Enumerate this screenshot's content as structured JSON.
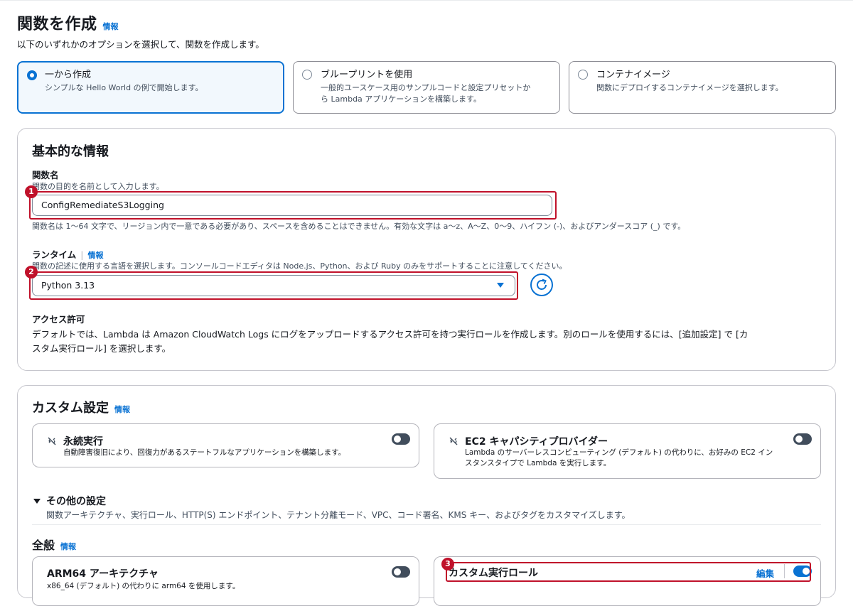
{
  "page": {
    "title": "関数を作成",
    "info": "情報",
    "description": "以下のいずれかのオプションを選択して、関数を作成します。"
  },
  "options": [
    {
      "title": "一から作成",
      "desc": "シンプルな Hello World の例で開始します。",
      "selected": true
    },
    {
      "title": "ブループリントを使用",
      "desc1": "一般的ユースケース用のサンプルコードと設定プリセットか",
      "desc2": "ら Lambda アプリケーションを構築します。",
      "selected": false
    },
    {
      "title": "コンテナイメージ",
      "desc": "関数にデプロイするコンテナイメージを選択します。",
      "selected": false
    }
  ],
  "basic": {
    "heading": "基本的な情報",
    "function_name": {
      "label": "関数名",
      "hint": "関数の目的を名前として入力します。",
      "value": "ConfigRemediateS3Logging",
      "constraint": "関数名は 1〜64 文字で、リージョン内で一意である必要があり、スペースを含めることはできません。有効な文字は a〜z、A〜Z、0〜9、ハイフン (-)、およびアンダースコア (_) です。"
    },
    "runtime": {
      "label": "ランタイム",
      "info": "情報",
      "hint": "関数の記述に使用する言語を選択します。コンソールコードエディタは Node.js、Python、および Ruby のみをサポートすることに注意してください。",
      "value": "Python 3.13"
    },
    "permissions": {
      "label": "アクセス許可",
      "text1": "デフォルトでは、Lambda は Amazon CloudWatch Logs にログをアップロードするアクセス許可を持つ実行ロールを作成します。別のロールを使用するには、[追加設定] で [カ",
      "text2": "スタム実行ロール] を選択します。"
    }
  },
  "custom": {
    "heading": "カスタム設定",
    "info": "情報",
    "durable": {
      "title": "永続実行",
      "desc": "自動障害復旧により、回復力があるステートフルなアプリケーションを構築します。",
      "enabled": false
    },
    "ec2": {
      "title": "EC2 キャパシティプロバイダー",
      "desc1": "Lambda のサーバーレスコンピューティング (デフォルト) の代わりに、お好みの EC2 イン",
      "desc2": "スタンスタイプで Lambda を実行します。",
      "enabled": false
    },
    "other": {
      "title": "その他の設定",
      "desc": "関数アーキテクチャ、実行ロール、HTTP(S) エンドポイント、テナント分離モード、VPC、コード署名、KMS キー、およびタグをカスタマイズします。"
    },
    "general": {
      "heading": "全般",
      "info": "情報"
    },
    "arm64": {
      "title": "ARM64 アーキテクチャ",
      "desc": "x86_64 (デフォルト) の代わりに arm64 を使用します。",
      "enabled": false
    },
    "role": {
      "title": "カスタム実行ロール",
      "edit": "編集",
      "enabled": true
    }
  },
  "annotations": [
    "1",
    "2",
    "3"
  ],
  "colors": {
    "accent": "#0972d3",
    "annotation": "#c0112a",
    "text": "#16191f"
  }
}
